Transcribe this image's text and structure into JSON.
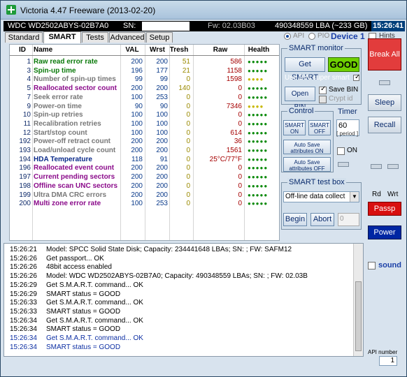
{
  "window": {
    "title": "Victoria 4.47  Freeware (2013-02-20)"
  },
  "infobar": {
    "drive": "WDC WD2502ABYS-02B7A0",
    "sn_label": "SN:",
    "fw": "Fw: 02.03B03",
    "lba": "490348559 LBA (~233 GB)",
    "clock": "15:26:41"
  },
  "tabs": [
    "Standard",
    "SMART",
    "Tests",
    "Advanced",
    "Setup"
  ],
  "mode": {
    "api": "API",
    "pio": "PIO",
    "device": "Device 1",
    "hints": "Hints"
  },
  "table": {
    "headers": {
      "id": "ID",
      "name": "Name",
      "val": "VAL",
      "wrst": "Wrst",
      "tresh": "Tresh",
      "raw": "Raw",
      "health": "Health"
    },
    "rows": [
      {
        "id": "1",
        "name": "Raw read error rate",
        "val": "200",
        "wrst": "200",
        "tresh": "51",
        "raw": "586",
        "health": "●●●●●",
        "health_color": "#0a8a0a",
        "name_color": "#0a7a0a"
      },
      {
        "id": "3",
        "name": "Spin-up time",
        "val": "196",
        "wrst": "177",
        "tresh": "21",
        "raw": "1158",
        "health": "●●●●●",
        "health_color": "#0a8a0a",
        "name_color": "#0a7a0a"
      },
      {
        "id": "4",
        "name": "Number of spin-up times",
        "val": "99",
        "wrst": "99",
        "tresh": "0",
        "raw": "1598",
        "health": "●●●●",
        "health_color": "#c8b800",
        "name_color": "#777777"
      },
      {
        "id": "5",
        "name": "Reallocated sector count",
        "val": "200",
        "wrst": "200",
        "tresh": "140",
        "raw": "0",
        "health": "●●●●●",
        "health_color": "#0a8a0a",
        "name_color": "#8a0a8a"
      },
      {
        "id": "7",
        "name": "Seek error rate",
        "val": "100",
        "wrst": "253",
        "tresh": "0",
        "raw": "0",
        "health": "●●●●●",
        "health_color": "#0a8a0a",
        "name_color": "#777777"
      },
      {
        "id": "9",
        "name": "Power-on time",
        "val": "90",
        "wrst": "90",
        "tresh": "0",
        "raw": "7346",
        "health": "●●●●",
        "health_color": "#c8b800",
        "name_color": "#777777"
      },
      {
        "id": "10",
        "name": "Spin-up retries",
        "val": "100",
        "wrst": "100",
        "tresh": "0",
        "raw": "0",
        "health": "●●●●●",
        "health_color": "#0a8a0a",
        "name_color": "#777777"
      },
      {
        "id": "11",
        "name": "Recalibration retries",
        "val": "100",
        "wrst": "100",
        "tresh": "0",
        "raw": "0",
        "health": "●●●●●",
        "health_color": "#0a8a0a",
        "name_color": "#777777"
      },
      {
        "id": "12",
        "name": "Start/stop count",
        "val": "100",
        "wrst": "100",
        "tresh": "0",
        "raw": "614",
        "health": "●●●●●",
        "health_color": "#0a8a0a",
        "name_color": "#777777"
      },
      {
        "id": "192",
        "name": "Power-off retract count",
        "val": "200",
        "wrst": "200",
        "tresh": "0",
        "raw": "36",
        "health": "●●●●●",
        "health_color": "#0a8a0a",
        "name_color": "#777777"
      },
      {
        "id": "193",
        "name": "Load/unload cycle count",
        "val": "200",
        "wrst": "200",
        "tresh": "0",
        "raw": "1561",
        "health": "●●●●●",
        "health_color": "#0a8a0a",
        "name_color": "#777777"
      },
      {
        "id": "194",
        "name": "HDA Temperature",
        "val": "118",
        "wrst": "91",
        "tresh": "0",
        "raw": "25°C/77°F",
        "health": "●●●●●",
        "health_color": "#0a8a0a",
        "name_color": "#0a2a8a"
      },
      {
        "id": "196",
        "name": "Reallocated event count",
        "val": "200",
        "wrst": "200",
        "tresh": "0",
        "raw": "0",
        "health": "●●●●●",
        "health_color": "#0a8a0a",
        "name_color": "#8a0a8a"
      },
      {
        "id": "197",
        "name": "Current pending sectors",
        "val": "200",
        "wrst": "200",
        "tresh": "0",
        "raw": "0",
        "health": "●●●●●",
        "health_color": "#0a8a0a",
        "name_color": "#8a0a8a"
      },
      {
        "id": "198",
        "name": "Offline scan UNC sectors",
        "val": "200",
        "wrst": "200",
        "tresh": "0",
        "raw": "0",
        "health": "●●●●●",
        "health_color": "#0a8a0a",
        "name_color": "#8a0a8a"
      },
      {
        "id": "199",
        "name": "Ultra DMA CRC errors",
        "val": "200",
        "wrst": "200",
        "tresh": "0",
        "raw": "0",
        "health": "●●●●●",
        "health_color": "#0a8a0a",
        "name_color": "#777777"
      },
      {
        "id": "200",
        "name": "Multi zone error rate",
        "val": "100",
        "wrst": "253",
        "tresh": "0",
        "raw": "0",
        "health": "●●●●●",
        "health_color": "#0a8a0a",
        "name_color": "#8a0a8a"
      }
    ]
  },
  "smart_monitor": {
    "title": "SMART monitor",
    "get_smart": "Get SMART",
    "status": "GOOD",
    "use_bin": "Use BIN super smart",
    "open_bin": "Open BIN",
    "save_bin": "Save BIN",
    "crypt": "Crypt id"
  },
  "control": {
    "title": "Control",
    "smart_on": "SMART ON",
    "smart_off": "SMART OFF",
    "autosave_on": "Auto Save attributes ON",
    "autosave_off": "Auto Save attributes OFF"
  },
  "timer": {
    "title": "Timer",
    "value": "60",
    "unit": "[ period ]",
    "on": "ON"
  },
  "test_box": {
    "title": "SMART test box",
    "selected": "Off-line data collect",
    "begin": "Begin",
    "abort": "Abort",
    "value": "0"
  },
  "right": {
    "break": "Break All",
    "sleep": "Sleep",
    "recall": "Recall",
    "rd": "Rd",
    "wrt": "Wrt",
    "passp": "Passp",
    "power": "Power",
    "sound": "sound",
    "api_number_label": "API number",
    "api_number": "1"
  },
  "log": [
    {
      "time": "15:26:21",
      "text": "Model: SPCC Solid State Disk; Capacity: 234441648 LBAs; SN:                              ; FW: SAFM12",
      "cls": ""
    },
    {
      "time": "15:26:26",
      "text": "Get passport... OK",
      "cls": ""
    },
    {
      "time": "15:26:26",
      "text": "48bit access enabled",
      "cls": ""
    },
    {
      "time": "15:26:26",
      "text": "Model: WDC WD2502ABYS-02B7A0; Capacity: 490348559 LBAs; SN:                              ; FW: 02.03B",
      "cls": ""
    },
    {
      "time": "15:26:29",
      "text": "Get S.M.A.R.T. command... OK",
      "cls": ""
    },
    {
      "time": "15:26:29",
      "text": "SMART status = GOOD",
      "cls": ""
    },
    {
      "time": "15:26:33",
      "text": "Get S.M.A.R.T. command... OK",
      "cls": ""
    },
    {
      "time": "15:26:33",
      "text": "SMART status = GOOD",
      "cls": ""
    },
    {
      "time": "15:26:34",
      "text": "Get S.M.A.R.T. command... OK",
      "cls": ""
    },
    {
      "time": "15:26:34",
      "text": "SMART status = GOOD",
      "cls": ""
    },
    {
      "time": "15:26:34",
      "text": "Get S.M.A.R.T. command... OK",
      "cls": "blue"
    },
    {
      "time": "15:26:34",
      "text": "SMART status = GOOD",
      "cls": "blue"
    }
  ]
}
